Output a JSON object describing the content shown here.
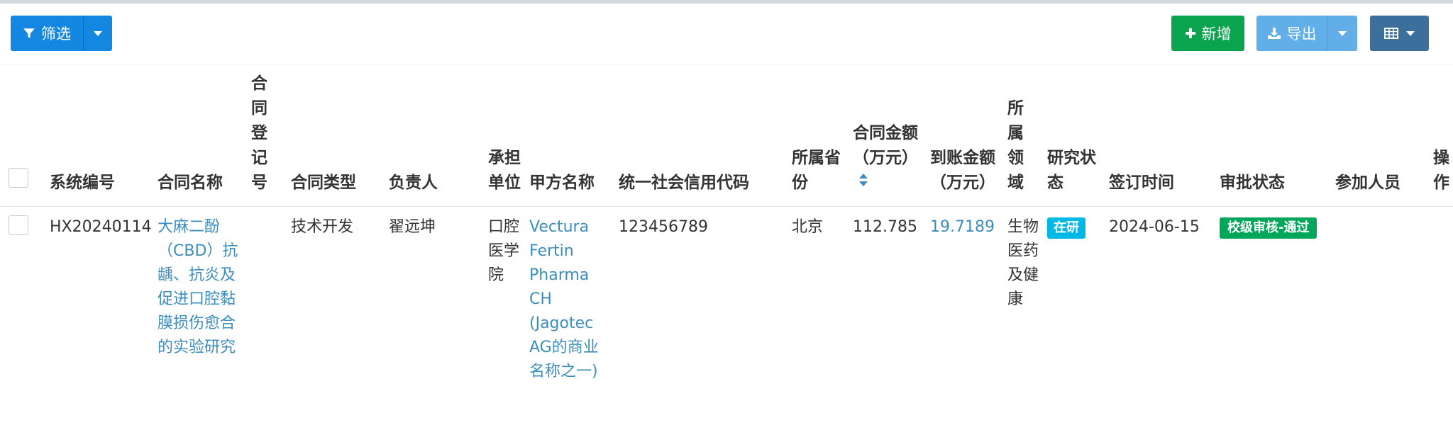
{
  "toolbar": {
    "filter_label": "筛选",
    "add_label": "新增",
    "export_label": "导出"
  },
  "table": {
    "columns": [
      "系统编号",
      "合同名称",
      "合同登记号",
      "合同类型",
      "负责人",
      "承担单位",
      "甲方名称",
      "统一社会信用代码",
      "所属省份",
      "合同金额（万元）",
      "到账金额（万元）",
      "所属领域",
      "研究状态",
      "签订时间",
      "审批状态",
      "参加人员",
      "操作"
    ],
    "rows": [
      {
        "sys_no": "HX20240114",
        "contract_name": "大麻二酚（CBD）抗龋、抗炎及促进口腔黏膜损伤愈合的实验研究",
        "reg_no": "",
        "contract_type": "技术开发",
        "owner": "翟远坤",
        "unit": "口腔医学院",
        "party_a": "Vectura Fertin Pharma CH (Jagotec AG的商业名称之一)",
        "credit_code": "123456789",
        "province": "北京",
        "amount": "112.785",
        "received": "19.7189",
        "field": "生物医药及健康",
        "research_status": "在研",
        "sign_date": "2024-06-15",
        "approval_status": "校级审核-通过",
        "participants": "",
        "actions": ""
      }
    ]
  },
  "colors": {
    "primary": "#1488e0",
    "success": "#0aa44e",
    "info": "#62aee8",
    "dark": "#3b6f9c",
    "link": "#3c8dbc",
    "badge_blue": "#00b8e6",
    "badge_green": "#00a65a"
  },
  "icons": [
    "filter-icon",
    "caret-down-icon",
    "plus-icon",
    "download-icon",
    "table-icon",
    "sort-icon"
  ]
}
